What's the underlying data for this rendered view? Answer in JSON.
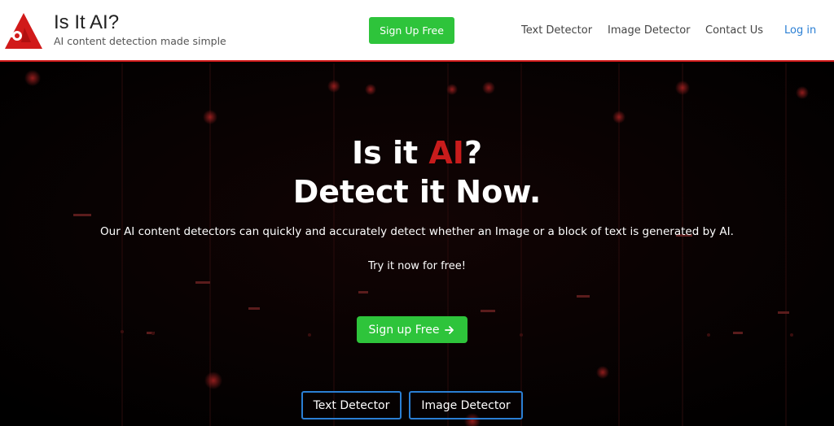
{
  "header": {
    "brand_title": "Is It AI?",
    "brand_tagline": "AI content detection made simple",
    "signup_label": "Sign Up Free",
    "nav": {
      "text_detector": "Text Detector",
      "image_detector": "Image Detector",
      "contact": "Contact Us",
      "login": "Log in"
    }
  },
  "hero": {
    "heading_line1_pre": "Is it ",
    "heading_line1_accent": "AI",
    "heading_line1_post": "?",
    "heading_line2": "Detect it Now.",
    "lead": "Our AI content detectors can quickly and accurately detect whether an Image or a block of text is generated by AI.",
    "try_text": "Try it now for free!",
    "cta_label": "Sign up Free",
    "cta_icon": "arrow-right-icon",
    "btn_text_detector": "Text Detector",
    "btn_image_detector": "Image Detector"
  },
  "colors": {
    "brand_red": "#c81c1c",
    "green": "#2ec43b",
    "link_blue": "#2a7fd4",
    "hero_bg": "#050505"
  }
}
